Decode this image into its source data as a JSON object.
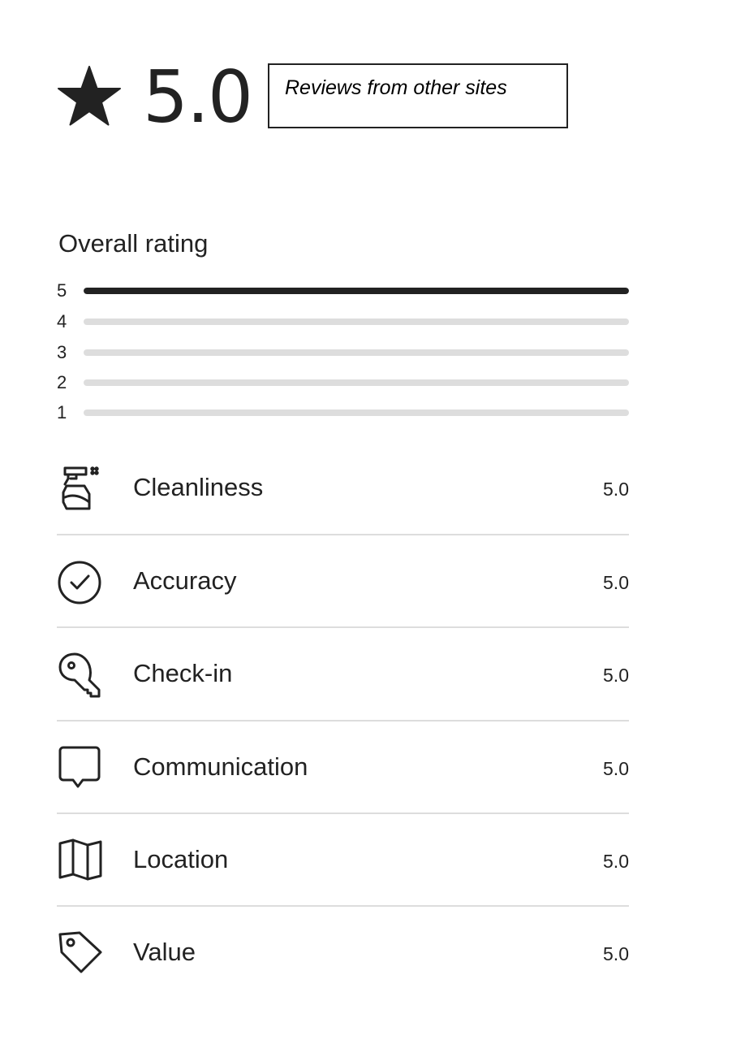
{
  "summary": {
    "star_icon": "star-icon",
    "score": "5.0",
    "other_sites_link": "Reviews from other sites"
  },
  "overall": {
    "title": "Overall rating",
    "distribution": [
      {
        "stars": "5",
        "fraction": 1.0
      },
      {
        "stars": "4",
        "fraction": 0.0
      },
      {
        "stars": "3",
        "fraction": 0.0
      },
      {
        "stars": "2",
        "fraction": 0.0
      },
      {
        "stars": "1",
        "fraction": 0.0
      }
    ]
  },
  "categories": [
    {
      "label": "Cleanliness",
      "value": "5.0",
      "icon": "spray-bottle-icon"
    },
    {
      "label": "Accuracy",
      "value": "5.0",
      "icon": "check-circle-icon"
    },
    {
      "label": "Check-in",
      "value": "5.0",
      "icon": "key-icon"
    },
    {
      "label": "Communication",
      "value": "5.0",
      "icon": "chat-bubble-icon"
    },
    {
      "label": "Location",
      "value": "5.0",
      "icon": "map-icon"
    },
    {
      "label": "Value",
      "value": "5.0",
      "icon": "tag-icon"
    }
  ],
  "colors": {
    "text": "#222222",
    "bar_filled": "#222222",
    "bar_empty": "#dddddd",
    "divider": "#dddddd"
  }
}
